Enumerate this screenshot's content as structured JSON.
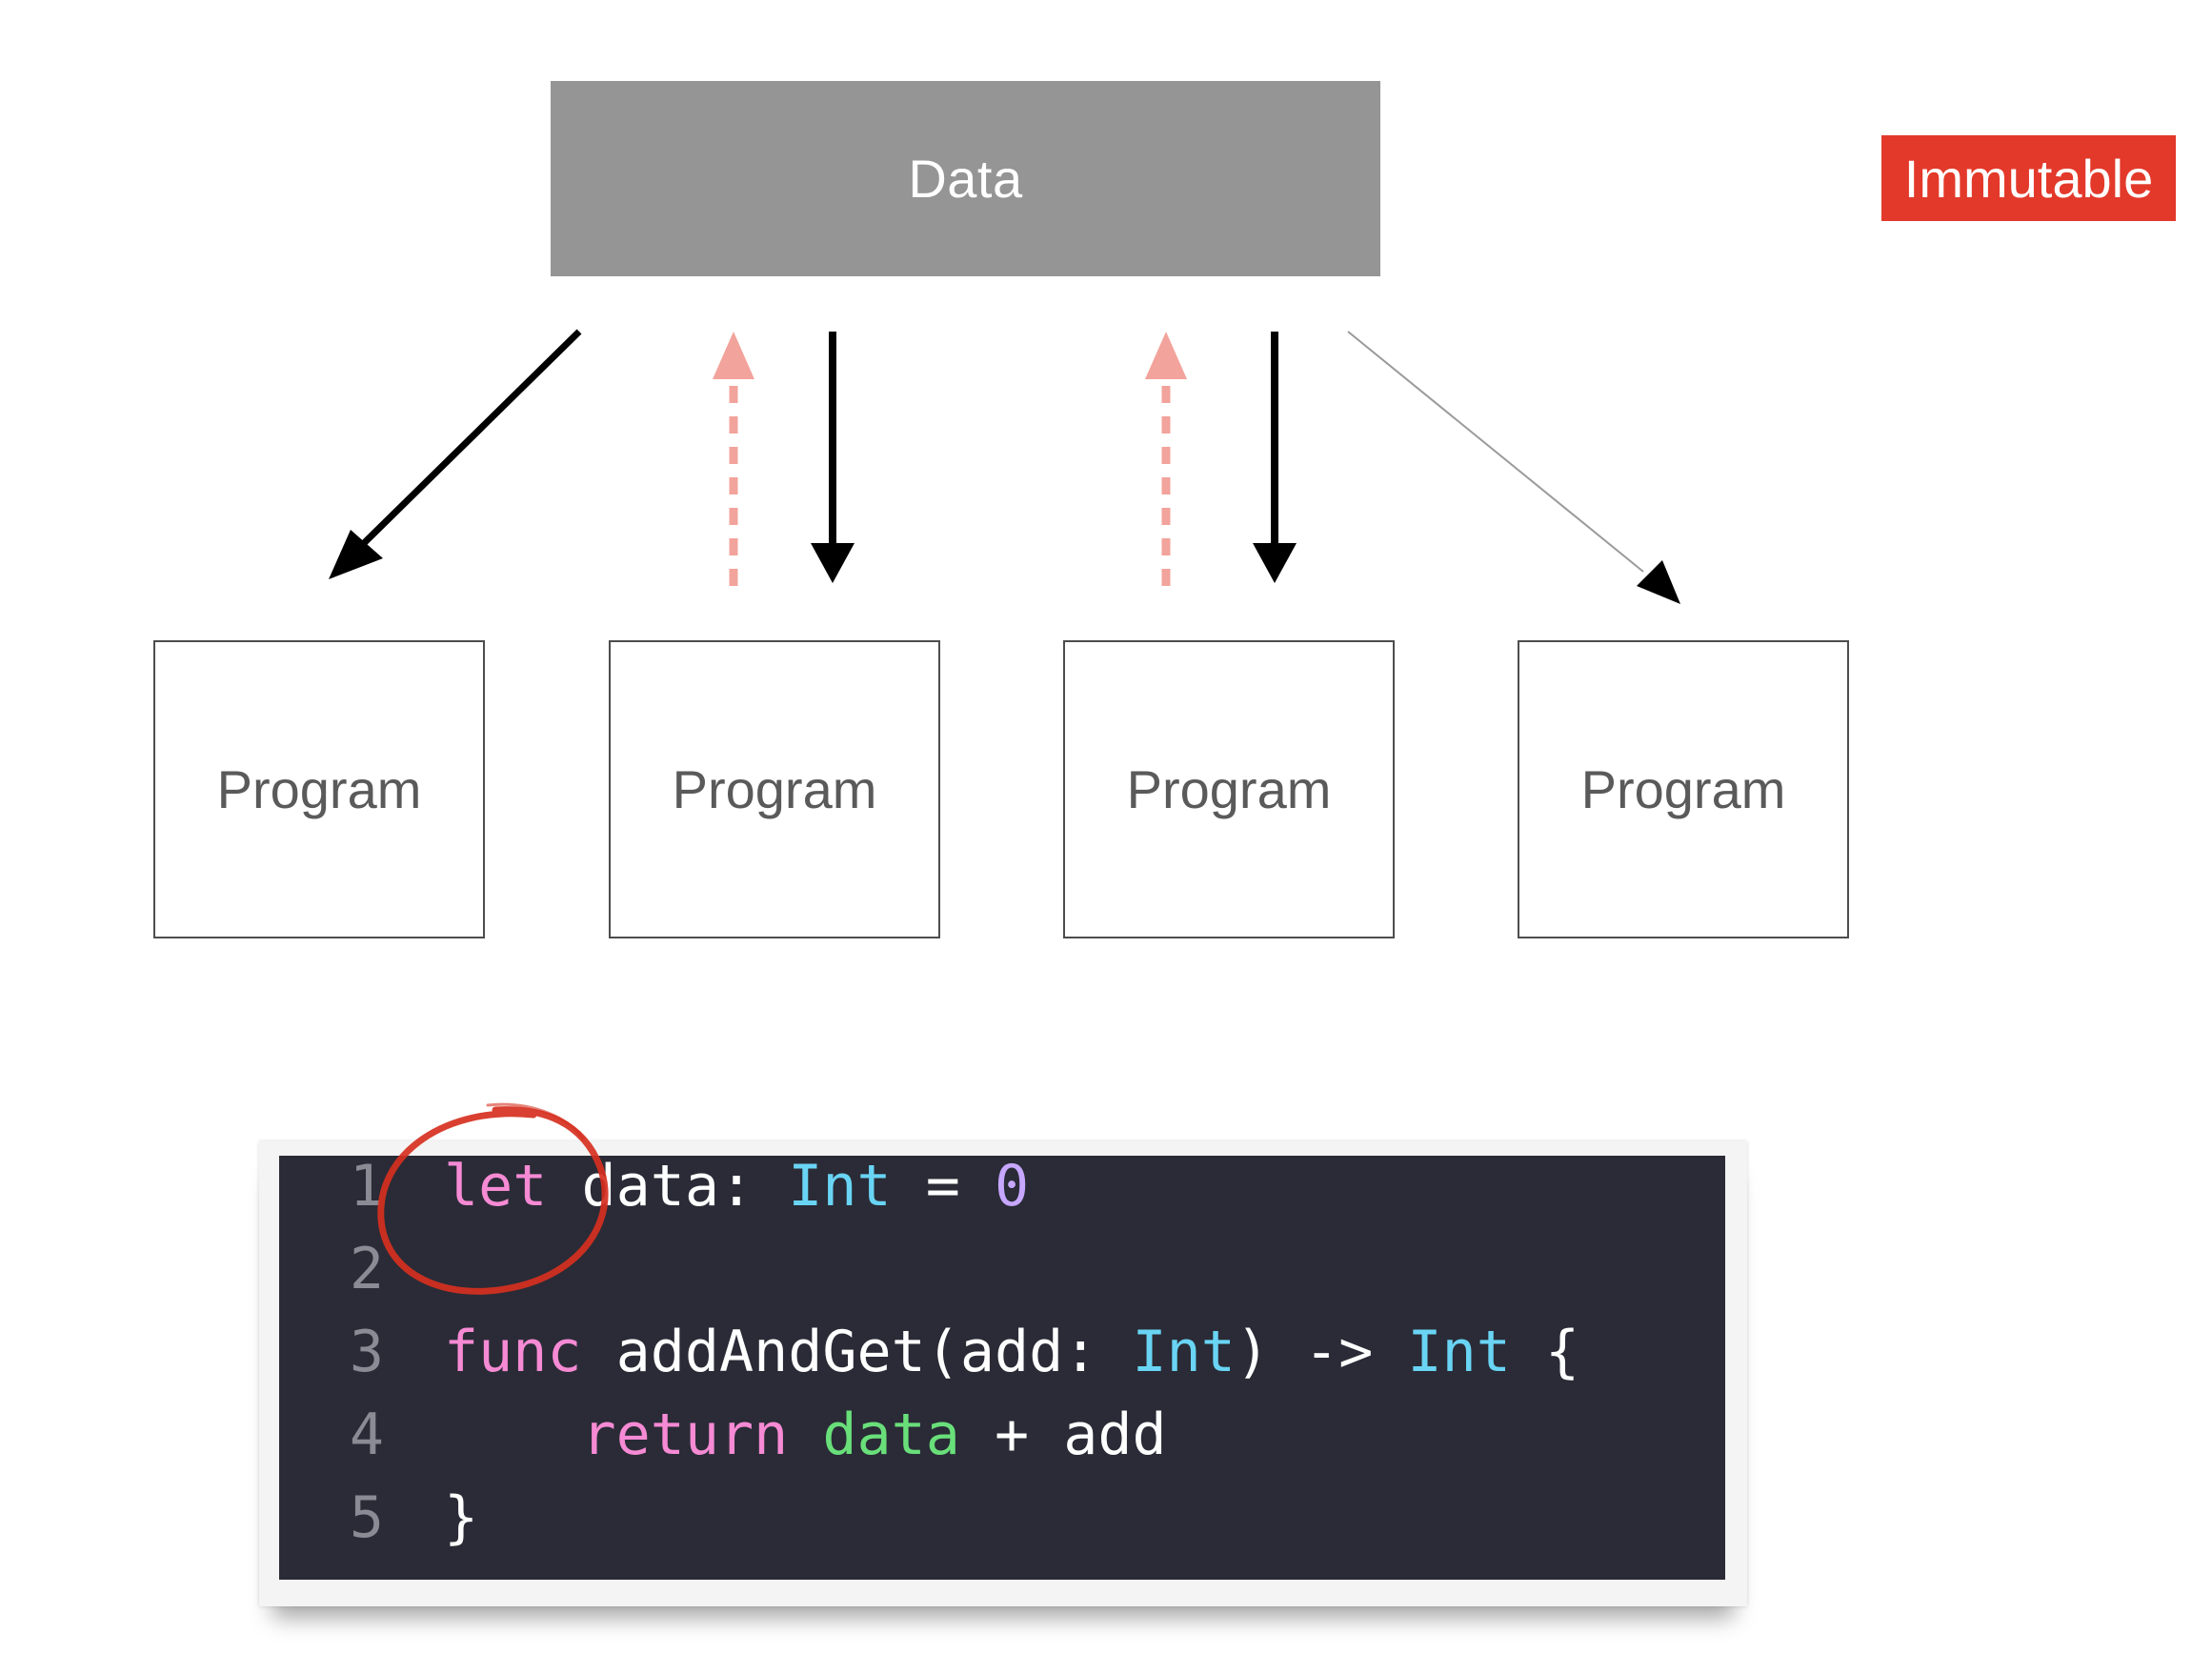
{
  "diagram": {
    "data_label": "Data",
    "badge_label": "Immutable",
    "program_labels": [
      "Program",
      "Program",
      "Program",
      "Program"
    ]
  },
  "code": {
    "lines": [
      {
        "number": "1",
        "tokens": [
          {
            "t": "let",
            "c": "kw"
          },
          {
            "t": " data: ",
            "c": "pl"
          },
          {
            "t": "Int",
            "c": "ty"
          },
          {
            "t": " = ",
            "c": "pl"
          },
          {
            "t": "0",
            "c": "num"
          }
        ]
      },
      {
        "number": "2",
        "tokens": []
      },
      {
        "number": "3",
        "tokens": [
          {
            "t": "func",
            "c": "kw"
          },
          {
            "t": " addAndGet(add: ",
            "c": "pl"
          },
          {
            "t": "Int",
            "c": "ty"
          },
          {
            "t": ") -> ",
            "c": "pl"
          },
          {
            "t": "Int",
            "c": "ty"
          },
          {
            "t": " {",
            "c": "pl"
          }
        ]
      },
      {
        "number": "4",
        "tokens": [
          {
            "t": "    ",
            "c": "pl"
          },
          {
            "t": "return",
            "c": "kw"
          },
          {
            "t": " ",
            "c": "pl"
          },
          {
            "t": "data",
            "c": "gr"
          },
          {
            "t": " + add",
            "c": "pl"
          }
        ]
      },
      {
        "number": "5",
        "tokens": [
          {
            "t": "}",
            "c": "pl"
          }
        ]
      }
    ]
  },
  "colors": {
    "data_box": "#959595",
    "badge": "#e3392a",
    "code_background": "#2a2b36",
    "keyword": "#f68ad4",
    "type": "#69d4f4",
    "number": "#c7a7ff",
    "identifier_highlight": "#69df7a",
    "write_arrow": "#f2a39b",
    "read_arrow": "#000000",
    "annotation_circle": "#d6301f"
  }
}
